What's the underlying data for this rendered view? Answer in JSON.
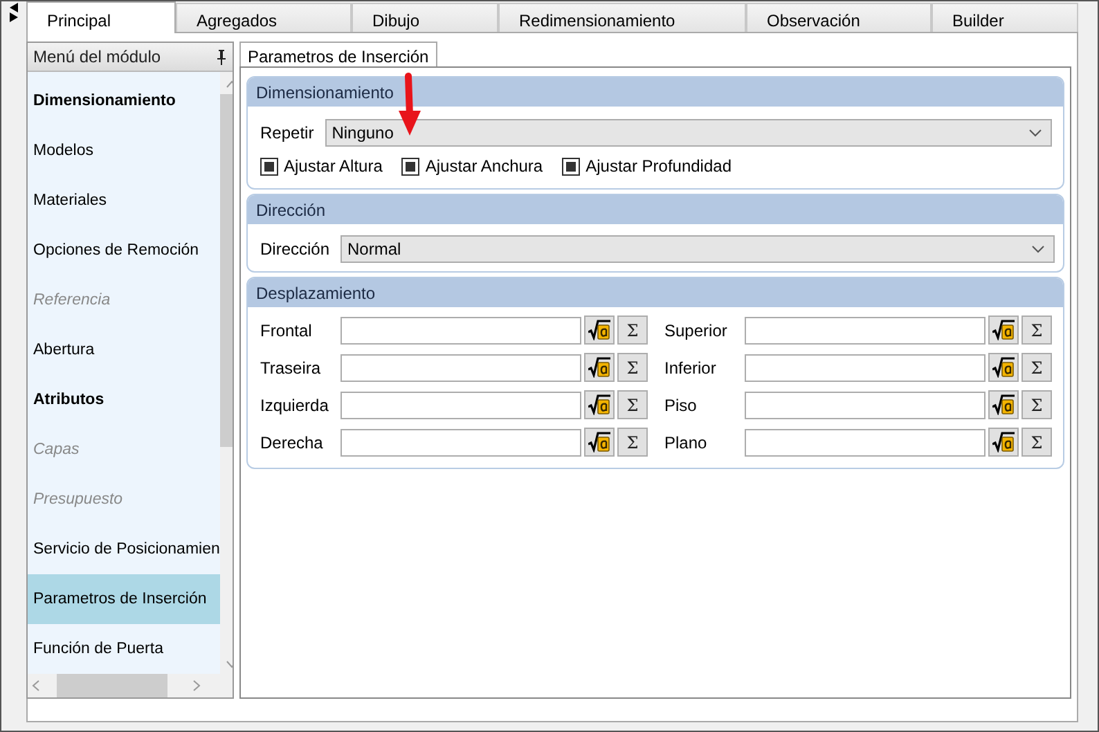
{
  "tabs": [
    {
      "label": "Principal",
      "selected": true
    },
    {
      "label": "Agregados",
      "selected": false
    },
    {
      "label": "Dibujo",
      "selected": false
    },
    {
      "label": "Redimensionamiento",
      "selected": false
    },
    {
      "label": "Observación",
      "selected": false
    },
    {
      "label": "Builder",
      "selected": false
    }
  ],
  "sidebar": {
    "title": "Menú del módulo",
    "items": [
      {
        "label": "Dimensionamiento",
        "kind": "header",
        "selected": false
      },
      {
        "label": "Modelos",
        "kind": "normal",
        "selected": false
      },
      {
        "label": "Materiales",
        "kind": "normal",
        "selected": false
      },
      {
        "label": "Opciones de Remoción",
        "kind": "normal",
        "selected": false
      },
      {
        "label": "Referencia",
        "kind": "disabled",
        "selected": false
      },
      {
        "label": "Abertura",
        "kind": "normal",
        "selected": false
      },
      {
        "label": "Atributos",
        "kind": "header",
        "selected": false
      },
      {
        "label": "Capas",
        "kind": "disabled",
        "selected": false
      },
      {
        "label": "Presupuesto",
        "kind": "disabled",
        "selected": false
      },
      {
        "label": "Servicio de Posicionamien",
        "kind": "normal",
        "selected": false
      },
      {
        "label": "Parametros de Inserción",
        "kind": "normal",
        "selected": true
      },
      {
        "label": "Función de Puerta",
        "kind": "normal",
        "selected": false
      }
    ]
  },
  "inner_tabs": [
    {
      "label": "Parametros de Inserción",
      "selected": true
    }
  ],
  "dimensionamiento": {
    "title": "Dimensionamiento",
    "repetir": {
      "label": "Repetir",
      "value": "Ninguno"
    },
    "checkboxes": [
      {
        "label": "Ajustar Altura",
        "checked": true
      },
      {
        "label": "Ajustar Anchura",
        "checked": true
      },
      {
        "label": "Ajustar Profundidad",
        "checked": true
      }
    ]
  },
  "direccion": {
    "title": "Dirección",
    "label": "Dirección",
    "value": "Normal"
  },
  "desplazamiento": {
    "title": "Desplazamiento",
    "fields": [
      {
        "label": "Frontal",
        "sum": "Σ"
      },
      {
        "label": "Superior",
        "sum": "Σ"
      },
      {
        "label": "Traseira",
        "sum": "Σ"
      },
      {
        "label": "Inferior",
        "sum": "Σ"
      },
      {
        "label": "Izquierda",
        "sum": "Σ"
      },
      {
        "label": "Piso",
        "sum": "Σ"
      },
      {
        "label": "Derecha",
        "sum": "Σ"
      },
      {
        "label": "Plano",
        "sum": "Σ"
      }
    ]
  }
}
